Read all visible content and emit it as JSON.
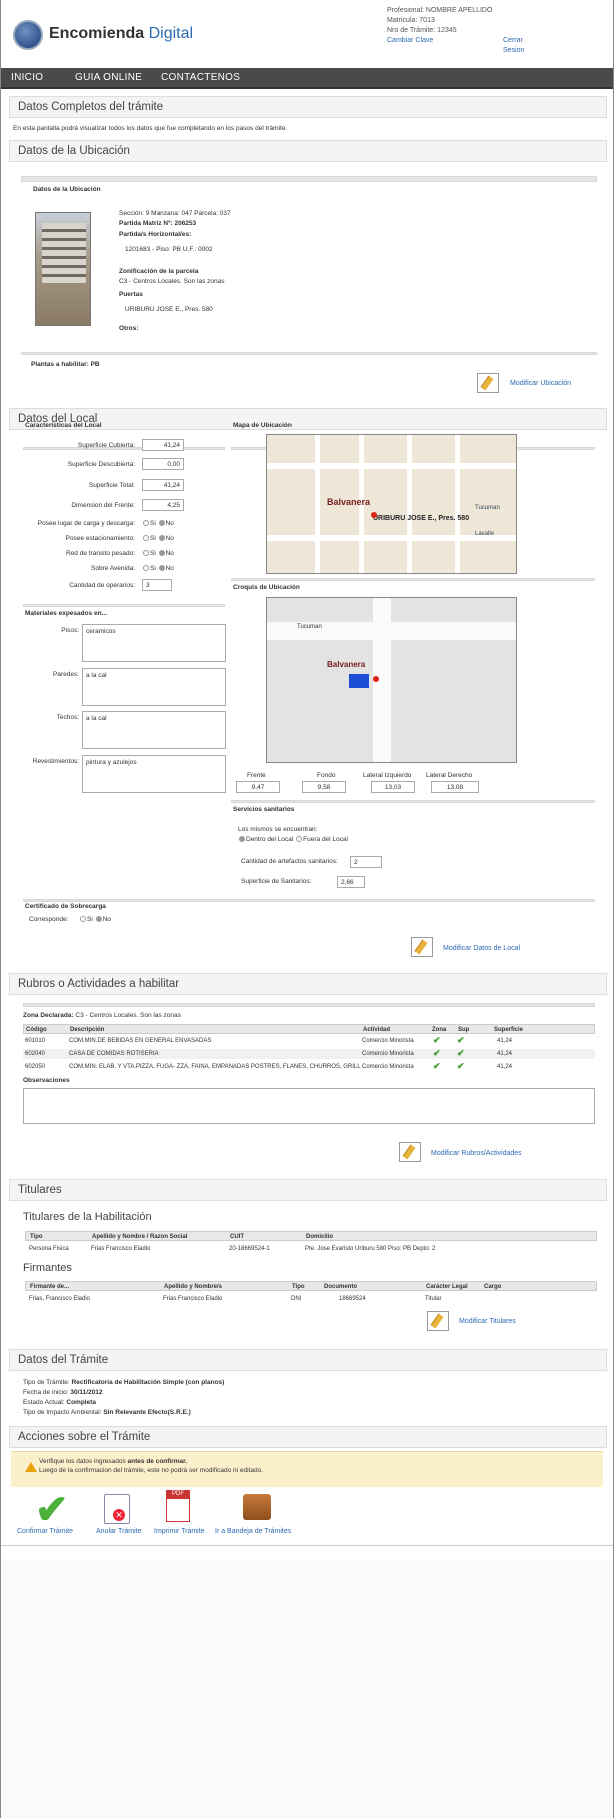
{
  "header": {
    "brand_1": "Encomienda",
    "brand_2": "Digital",
    "profesional": "Profesional: NOMBRE APELLIDO",
    "matricula": "Matricula: 7013",
    "tramite": "Nro de Trámite: 12345",
    "cambiar": "Cambiar Clave",
    "cerrar": "Cerrar Sesion"
  },
  "nav": {
    "inicio": "INICIO",
    "guia": "GUIA ONLINE",
    "contacto": "CONTACTENOS"
  },
  "s1": {
    "title": "Datos Completos del trámite",
    "desc": "En esta pantalla podrá visualizar todos los datos que fue completando en los pasos del trámite."
  },
  "ubic": {
    "title": "Datos de la Ubicación",
    "sub": "Datos de la Ubicación",
    "seccion": "Sección: 9 Manzana: 047 Parcela: 037",
    "partida": "Partida Matriz Nº: 206253",
    "horizontal": "Partida/s Horizontal/es:",
    "horiz_val": "1201683 - Piso: PB U.F.: 0002",
    "zon_lbl": "Zonificación de la parcela",
    "zon_val": "C3 - Centros Locales. Son las zonas",
    "puertas_lbl": "Puertas",
    "puertas_val": "URIBURU JOSE E., Pres.  580",
    "otros": "Otros:",
    "plantas": "Plantas a habilitar: PB",
    "modificar": "Modificar Ubicación"
  },
  "local": {
    "title": "Datos del Local",
    "caract": "Características del Local",
    "sup_cub": "Superficie Cubierta:",
    "sup_cub_v": "41,24",
    "sup_desc": "Superficie Descubierta:",
    "sup_desc_v": "0,00",
    "sup_tot": "Superficie Total:",
    "sup_tot_v": "41,24",
    "dim_fr": "Dimension del Frente:",
    "dim_fr_v": "4,25",
    "carga": "Posee lugar de carga y descarga:",
    "estac": "Posee estacionamiento:",
    "red": "Red de transito pesado:",
    "avenida": "Sobre Avenida:",
    "si": "Si",
    "no": "No",
    "cant_op": "Cantidad de operarios:",
    "cant_op_v": "3",
    "materiales": "Materiales expesados en...",
    "pisos": "Pisos:",
    "pisos_v": "ceramicos",
    "paredes": "Paredes:",
    "paredes_v": "a la cal",
    "techos": "Techos:",
    "techos_v": "a la cal",
    "revest": "Revestimientos:",
    "revest_v": "pintura y azulejos",
    "mapa": "Mapa de Ubicación",
    "croquis": "Croquis de Ubicación",
    "map_barrio": "Balvanera",
    "map_addr": "URIBURU JOSE E., Pres. 580",
    "map_tucuman": "Tucuman",
    "map_lavalle": "Lavalle",
    "frente": "Frente",
    "frente_v": "9,47",
    "fondo": "Fondo",
    "fondo_v": "9,58",
    "lat_izq": "Lateral Izquierdo",
    "lat_izq_v": "13,03",
    "lat_der": "Lateral Derecho",
    "lat_der_v": "13,08",
    "serv": "Servicios sanitarios",
    "mismos": "Los mismos se encuentran:",
    "dentro": "Dentro del Local",
    "fuera": "Fuera del Local",
    "cant_art": "Cantidad de artefactos sanitarios:",
    "cant_art_v": "2",
    "sup_san": "Superficie de Sanitarios:",
    "sup_san_v": "2,66",
    "cert": "Certificado de Sobrecarga",
    "corresponde": "Corresponde:",
    "modificar": "Modificar Datos de Local"
  },
  "rubros": {
    "title": "Rubros o Actividades a habilitar",
    "zona": "Zona Declarada:",
    "zona_v": "C3 - Centros Locales. Son las zonas",
    "h_cod": "Código",
    "h_desc": "Descripción",
    "h_act": "Actividad",
    "h_zona": "Zona",
    "h_sup": "Sup",
    "h_superf": "Superficie",
    "rows": [
      {
        "cod": "601010",
        "desc": "COM.MIN.DE BEBIDAS EN GENERAL ENVASADAS",
        "act": "Comercio Minorista",
        "sup": "41,24"
      },
      {
        "cod": "602040",
        "desc": "CASA DE COMIDAS ROTISERIA",
        "act": "Comercio Minorista",
        "sup": "41,24"
      },
      {
        "cod": "602050",
        "desc": "COM.MIN. ELAB. Y VTA.PIZZA, FUGA- ZZA, FAINA, EMPANADAS POSTRES, FLANES, CHURROS, GRILL",
        "act": "Comercio Minorista",
        "sup": "41,24"
      }
    ],
    "obs": "Observaciones",
    "modificar": "Modificar Rubros/Actividades"
  },
  "titulares": {
    "title": "Titulares",
    "sub": "Titulares de la Habilitación",
    "h_tipo": "Tipo",
    "h_nombre": "Apellido y Nombre / Razon Social",
    "h_cuit": "CUIT",
    "h_dom": "Domicilio",
    "tipo": "Persona Fisica",
    "nombre": "Frias Francisco Eladio",
    "cuit": "20-18669524-1",
    "dom": "Pte. Jose Evaristo Uriburu 580 Piso: PB Depto: 2",
    "firmantes": "Firmantes",
    "f_h1": "Firmante de...",
    "f_h2": "Apellido y Nombre/s",
    "f_h3": "Tipo",
    "f_h4": "Documento",
    "f_h5": "Carácter Legal",
    "f_h6": "Cargo",
    "f_1": "Frias, Francisco Eladio",
    "f_2": "Frias Francisco Eladio",
    "f_3": "DNI",
    "f_4": "18669524",
    "f_5": "Titular",
    "modificar": "Modificar Titulares"
  },
  "tramite": {
    "title": "Datos del Trámite",
    "tipo_l": "Tipo de Trámite:",
    "tipo_v": "Rectificatoria de Habilitación Simple (con planos)",
    "fecha_l": "Fecha de inicio:",
    "fecha_v": "30/11/2012",
    "estado_l": "Estado Actual:",
    "estado_v": "Completa",
    "impacto_l": "Tipo de Impacto Ambiental:",
    "impacto_v": "Sin Relevante Efecto(S.R.E.)"
  },
  "acciones": {
    "title": "Acciones sobre el Trámite",
    "warn1_a": "Verifique los datos ingresados ",
    "warn1_b": "antes de confirmar.",
    "warn2": "Luego de la confirmacion del trámite, este no podrá ser modificado ni editado.",
    "confirmar": "Confirmar Trámite",
    "anular": "Anular Trámite",
    "imprimir": "Imprimir Trámite",
    "bandeja": "Ir a Bandeja de Trámites",
    "pdf": "PDF"
  },
  "colors": {
    "accent": "#2b6ab3",
    "nav": "#4a4a4a",
    "check": "#3b9b2a"
  }
}
